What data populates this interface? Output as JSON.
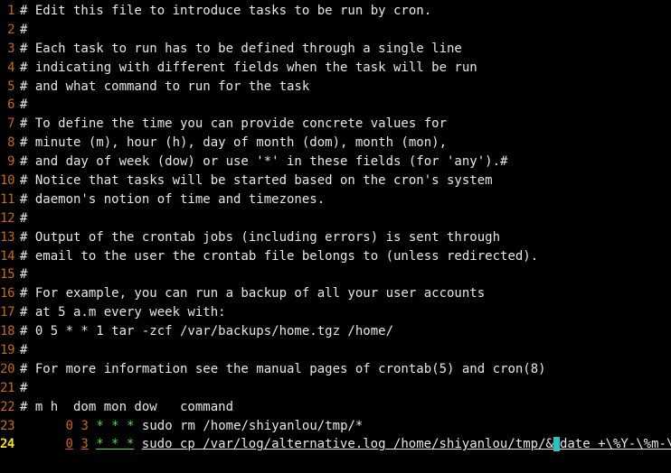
{
  "lines": [
    {
      "n": "1",
      "text": "# Edit this file to introduce tasks to be run by cron."
    },
    {
      "n": "2",
      "text": "#"
    },
    {
      "n": "3",
      "text": "# Each task to run has to be defined through a single line"
    },
    {
      "n": "4",
      "text": "# indicating with different fields when the task will be run"
    },
    {
      "n": "5",
      "text": "# and what command to run for the task"
    },
    {
      "n": "6",
      "text": "#"
    },
    {
      "n": "7",
      "text": "# To define the time you can provide concrete values for"
    },
    {
      "n": "8",
      "text": "# minute (m), hour (h), day of month (dom), month (mon),"
    },
    {
      "n": "9",
      "text": "# and day of week (dow) or use '*' in these fields (for 'any').#"
    },
    {
      "n": "10",
      "text": "# Notice that tasks will be started based on the cron's system"
    },
    {
      "n": "11",
      "text": "# daemon's notion of time and timezones."
    },
    {
      "n": "12",
      "text": "#"
    },
    {
      "n": "13",
      "text": "# Output of the crontab jobs (including errors) is sent through"
    },
    {
      "n": "14",
      "text": "# email to the user the crontab file belongs to (unless redirected)."
    },
    {
      "n": "15",
      "text": "#"
    },
    {
      "n": "16",
      "text": "# For example, you can run a backup of all your user accounts"
    },
    {
      "n": "17",
      "text": "# at 5 a.m every week with:"
    },
    {
      "n": "18",
      "text": "# 0 5 * * 1 tar -zcf /var/backups/home.tgz /home/"
    },
    {
      "n": "19",
      "text": "#"
    },
    {
      "n": "20",
      "text": "# For more information see the manual pages of crontab(5) and cron(8)"
    },
    {
      "n": "21",
      "text": "#"
    },
    {
      "n": "22",
      "text": "# m h  dom mon dow   command"
    }
  ],
  "job1": {
    "n": "23",
    "minute": "0",
    "hour": "3",
    "stars": "* * *",
    "command": "sudo rm /home/shiyanlou/tmp/*"
  },
  "job2": {
    "n": "24",
    "minute": "0",
    "hour": "3",
    "stars": "* * *",
    "command_a": "sudo cp /var/log/alternative.log /home/shiyanlou/tmp/&",
    "command_b": "date +\\%Y-\\%m-\\%d"
  },
  "colors": {
    "background": "#000000",
    "line_number": "#c46a14",
    "current_line_number": "#f2e21a",
    "text": "#e7e7e7",
    "star_fields": "#4de04d",
    "bracket_highlight": "#27c3c3",
    "cursor": "#38d338"
  }
}
